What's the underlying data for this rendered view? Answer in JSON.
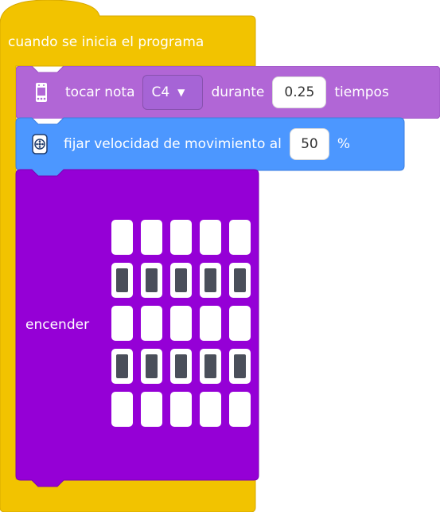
{
  "colors": {
    "hat_block": "#f2c300",
    "hat_border": "#d7a800",
    "sound_block": "#b166d6",
    "sound_border": "#9c52c3",
    "motion_block": "#4c97ff",
    "motion_border": "#3a7ee0",
    "display_block": "#9500d6",
    "display_border": "#7a00b3",
    "led_on": "#4a4f5a",
    "led_off": "#ffffff"
  },
  "hat": {
    "title": "cuando se inicia el programa"
  },
  "play_note": {
    "icon": "microbit-icon",
    "label_play": "tocar nota",
    "note_value": "C4",
    "label_during": "durante",
    "beats_value": "0.25",
    "label_beats": "tiempos"
  },
  "set_speed": {
    "icon": "motor-icon",
    "label": "fijar velocidad de movimiento al",
    "speed_value": "50",
    "unit": "%"
  },
  "light_up": {
    "label": "encender",
    "matrix": [
      [
        0,
        0,
        0,
        0,
        0
      ],
      [
        1,
        1,
        1,
        1,
        1
      ],
      [
        0,
        0,
        0,
        0,
        0
      ],
      [
        1,
        1,
        1,
        1,
        1
      ],
      [
        0,
        0,
        0,
        0,
        0
      ]
    ]
  }
}
